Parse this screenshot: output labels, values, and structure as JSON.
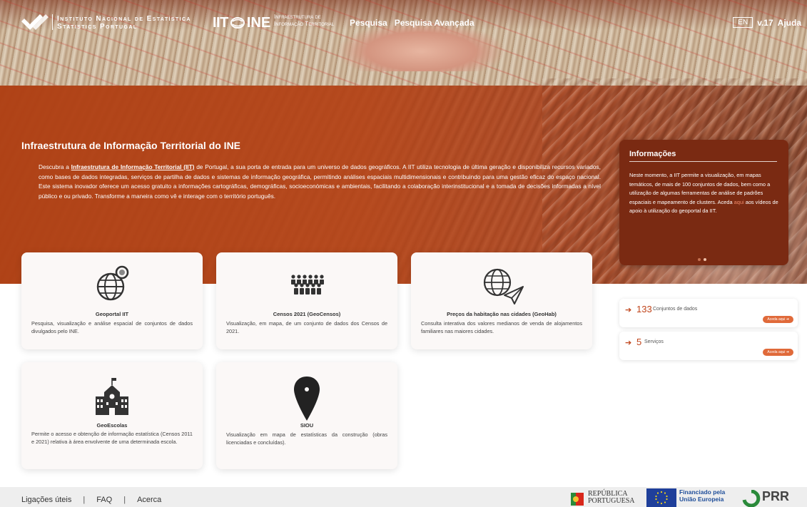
{
  "header": {
    "ine_line1": "Instituto Nacional de Estatística",
    "ine_line2": "Statistics Portugal",
    "iit": "IIT",
    "ine": "INE",
    "iit_sub_line1": "Infraestrutura de",
    "iit_sub_line2": "Informação Territorial",
    "nav": [
      "Pesquisa",
      "Pesquisa Avançada"
    ],
    "lang": "EN",
    "version": "v.17",
    "help": "Ajuda"
  },
  "intro": {
    "title": "Infraestrutura de Informação Territorial do INE",
    "text_before": "Descubra a ",
    "text_emphasis": "Infraestrutura de Informação Territorial (IIT)",
    "text_after": " de Portugal, a sua porta de entrada para um universo de dados geográficos. A IIT utiliza tecnologia de última geração e disponibiliza recursos variados, como bases de dados integradas, serviços de partilha de dados e sistemas de informação geográfica, permitindo análises espaciais multidimensionais e contribuindo para uma gestão eficaz do espaço nacional. Este sistema inovador oferece um acesso gratuito a informações cartográficas, demográficas, socioeconómicas e ambientais, facilitando a colaboração interinstitucional e a tomada de decisões informadas a nível público e ou privado. Transforme a maneira como vê e interage com o território português."
  },
  "info": {
    "title": "Informações",
    "text_before": "Neste momento, a IIT permite a visualização, em mapas temáticos, de mais de 100 conjuntos de dados, bem como a utilização de algumas ferramentas de análise de padrões espaciais e mapeamento de clusters. Aceda ",
    "link": "aqui",
    "text_after": " aos vídeos de apoio à utilização do geoportal da IIT."
  },
  "cards": [
    {
      "title": "Geoportal IIT",
      "icon": "globe-search-icon",
      "desc": "Pesquisa, visualização e análise espacial de conjuntos de dados divulgados pelo INE."
    },
    {
      "title": "Censos 2021 (GeoCensos)",
      "icon": "crowd-icon",
      "desc": "Visualização, em mapa, de um conjunto de dados dos Censos de 2021."
    },
    {
      "title": "Preços da habitação nas cidades (GeoHab)",
      "icon": "globe-send-icon",
      "desc": "Consulta interativa dos valores medianos de venda de alojamentos familiares nas maiores cidades."
    },
    {
      "title": "GeoEscolas",
      "icon": "school-icon",
      "desc": "Permite o acesso e obtenção de informação estatística (Censos 2011 e 2021) relativa à área envolvente de uma determinada escola."
    },
    {
      "title": "SIOU",
      "icon": "map-pin-icon",
      "desc": "Visualização em mapa de estatísticas da construção (obras licenciadas e concluídas)."
    }
  ],
  "stats": [
    {
      "value": "133",
      "label": "Conjuntos de dados",
      "action": "Aceda aqui ➔"
    },
    {
      "value": "5",
      "label": "Serviços",
      "action": "Aceda aqui ➔"
    }
  ],
  "footer": {
    "links": [
      "Ligações úteis",
      "FAQ",
      "Acerca"
    ],
    "rp_line1": "REPÚBLICA",
    "rp_line2": "PORTUGUESA",
    "eu_line1": "Financiado pela",
    "eu_line2": "União Europeia",
    "prr": "PRR"
  },
  "colors": {
    "accent": "#c0441a",
    "hero": "#b04216",
    "info_panel": "#7a2a12"
  }
}
